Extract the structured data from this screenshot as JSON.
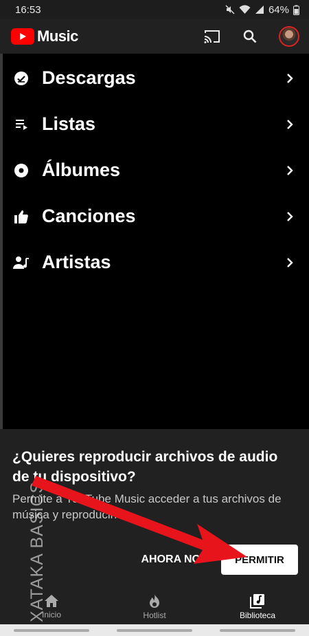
{
  "status_bar": {
    "time": "16:53",
    "battery": "64%"
  },
  "app_bar": {
    "logo_text": "Music"
  },
  "library_menu": [
    {
      "label": "Descargas",
      "icon": "download-done-icon"
    },
    {
      "label": "Listas",
      "icon": "playlist-icon"
    },
    {
      "label": "Álbumes",
      "icon": "album-icon"
    },
    {
      "label": "Canciones",
      "icon": "thumbs-up-icon"
    },
    {
      "label": "Artistas",
      "icon": "artist-icon"
    }
  ],
  "permission_sheet": {
    "title": "¿Quieres reproducir archivos de audio de tu dispositivo?",
    "body": "Permite a YouTube Music acceder a tus archivos de música y reproducirlos",
    "decline_label": "AHORA NO",
    "allow_label": "PERMITIR"
  },
  "bottom_nav": [
    {
      "label": "Inicio",
      "icon": "home-icon",
      "active": false
    },
    {
      "label": "Hotlist",
      "icon": "flame-icon",
      "active": false
    },
    {
      "label": "Biblioteca",
      "icon": "library-icon",
      "active": true
    }
  ],
  "watermark": "XATAKA BASICS",
  "colors": {
    "brand": "#ff0000",
    "arrow": "#e8141c",
    "surface": "#212121"
  }
}
